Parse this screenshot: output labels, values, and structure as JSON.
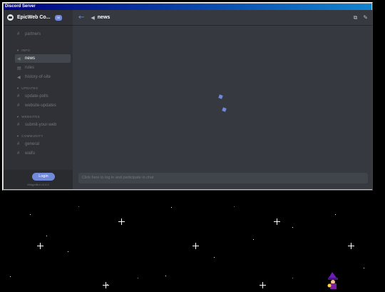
{
  "window": {
    "title": "Discord Server"
  },
  "server": {
    "name": "EpicWeb Co...",
    "badge": "36"
  },
  "sidebar": {
    "top_channels": [
      {
        "label": "partners",
        "icon": "hash"
      }
    ],
    "categories": [
      {
        "name": "INFO",
        "channels": [
          {
            "label": "news",
            "icon": "megaphone",
            "active": true
          },
          {
            "label": "rules",
            "icon": "book"
          },
          {
            "label": "history-of-site",
            "icon": "megaphone"
          }
        ]
      },
      {
        "name": "UPDATES",
        "channels": [
          {
            "label": "update-polls",
            "icon": "hash"
          },
          {
            "label": "website-updates",
            "icon": "hash"
          }
        ]
      },
      {
        "name": "WEBSITES",
        "channels": [
          {
            "label": "submit-your-web",
            "icon": "hash"
          }
        ]
      },
      {
        "name": "COMMUNITY",
        "channels": [
          {
            "label": "general",
            "icon": "hash"
          },
          {
            "label": "waifu",
            "icon": "hash"
          }
        ]
      }
    ],
    "login_label": "Login",
    "version": "WidgetBot v3.0.0"
  },
  "channel_header": {
    "name": "news",
    "icon": "megaphone"
  },
  "chat": {
    "input_placeholder": "Click here to log in and participate in chat"
  },
  "colors": {
    "accent": "#7289da",
    "sidebar": "#2f3136",
    "main": "#36393f",
    "titlebar": "#000080"
  }
}
